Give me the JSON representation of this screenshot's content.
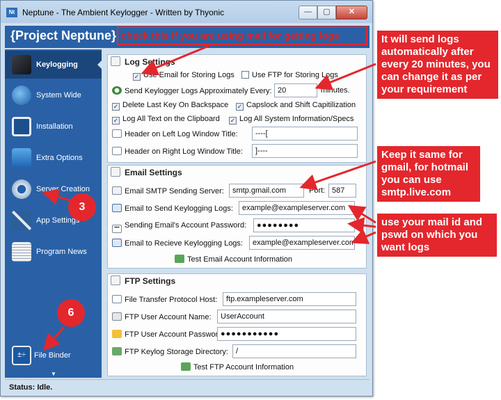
{
  "window": {
    "title": "Neptune - The Ambient Keylogger - Written by Thyonic",
    "app_icon_text": "Nt",
    "min_glyph": "—",
    "max_glyph": "▢",
    "close_glyph": "✕"
  },
  "header": {
    "title": "{Project Neptune}"
  },
  "sidebar": {
    "items": [
      {
        "label": "Keylogging",
        "icon": "keyboard-icon",
        "active": true
      },
      {
        "label": "System Wide",
        "icon": "globe-icon"
      },
      {
        "label": "Installation",
        "icon": "monitor-icon"
      },
      {
        "label": "Extra Options",
        "icon": "app-store-icon"
      },
      {
        "label": "Server Creation",
        "icon": "gear-icon"
      },
      {
        "label": "App Settings",
        "icon": "tools-icon"
      },
      {
        "label": "Program News",
        "icon": "newspaper-icon"
      }
    ],
    "bottom_item": {
      "label": "File Binder",
      "icon": "calculator-icon"
    },
    "scroll_glyph": "▼"
  },
  "log_settings": {
    "title": "Log Settings",
    "use_email": {
      "label": "Use Email for Storing Logs",
      "checked": true
    },
    "use_ftp": {
      "label": "Use FTP for Storing Logs",
      "checked": false
    },
    "send_interval_label": "Send Keylogger Logs Approximately Every:",
    "send_interval_value": "20",
    "send_interval_unit": "minutes.",
    "delete_last_key": {
      "label": "Delete Last Key On Backspace",
      "checked": true
    },
    "capslock": {
      "label": "Capslock and Shift Capitilization",
      "checked": true
    },
    "log_clipboard": {
      "label": "Log All Text on the Clipboard",
      "checked": true
    },
    "log_sysinfo": {
      "label": "Log All System Information/Specs",
      "checked": true
    },
    "header_left_label": "Header on Left Log Window Title:",
    "header_left_value": "----[",
    "header_right_label": "Header on Right Log Window Title:",
    "header_right_value": "]----"
  },
  "email_settings": {
    "title": "Email Settings",
    "smtp_label": "Email SMTP Sending Server:",
    "smtp_value": "smtp.gmail.com",
    "port_label": "Port:",
    "port_value": "587",
    "send_to_label": "Email to Send Keylogging Logs:",
    "send_to_value": "example@exampleserver.com",
    "password_label": "Sending Email's Account Password:",
    "password_value": "●●●●●●●●",
    "receive_label": "Email to Recieve Keylogging Logs:",
    "receive_value": "example@exampleserver.com",
    "test_button": "Test Email Account Information"
  },
  "ftp_settings": {
    "title": "FTP Settings",
    "host_label": "File Transfer Protocol Host:",
    "host_value": "ftp.exampleserver.com",
    "user_label": "FTP User Account Name:",
    "user_value": "UserAccount",
    "pass_label": "FTP User Account Password:",
    "pass_value": "●●●●●●●●●●●",
    "dir_label": "FTP Keylog Storage Directory:",
    "dir_value": "/",
    "test_button": "Test FTP Account Information"
  },
  "status": {
    "text": "Status: Idle."
  },
  "annotations": {
    "check_email": "check this if you are using mail for getting logs",
    "interval_note": "It will send logs automatically after every 20 minutes, you can change it as per your requirement",
    "smtp_note": "Keep it same for gmail, for hotmail you can use smtp.live.com",
    "mail_note": "use your mail id and pswd on which you want logs",
    "circle_3": "3",
    "circle_6": "6",
    "accent_color": "#e3272d"
  }
}
